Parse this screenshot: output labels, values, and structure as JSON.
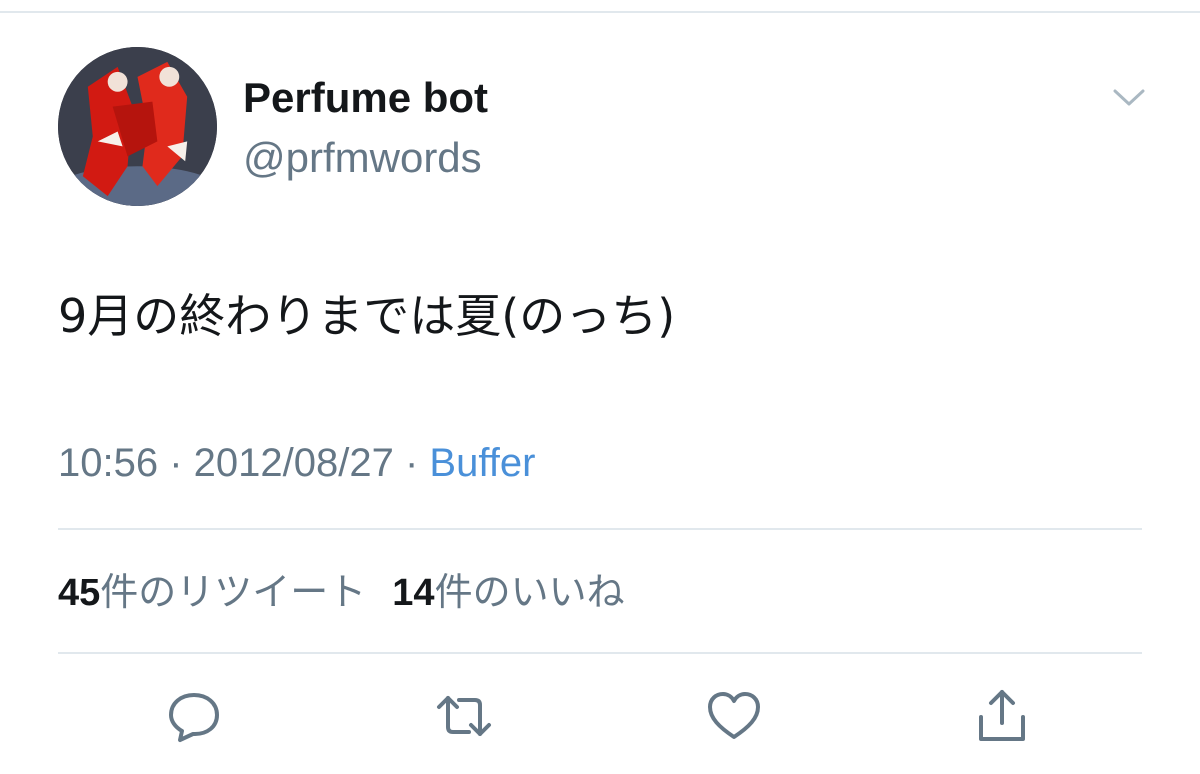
{
  "tweet": {
    "author": {
      "display_name": "Perfume bot",
      "handle": "@prfmwords",
      "avatar_icon": "avatar-photo"
    },
    "text": "9月の終わりまでは夏(のっち)",
    "meta": {
      "time": "10:56",
      "separator": " · ",
      "date": "2012/08/27",
      "source": "Buffer"
    },
    "stats": {
      "retweets_count": "45",
      "retweets_label": "件のリツイート",
      "likes_count": "14",
      "likes_label": "件のいいね"
    },
    "actions": [
      {
        "name": "reply",
        "icon": "reply-icon"
      },
      {
        "name": "retweet",
        "icon": "retweet-icon"
      },
      {
        "name": "like",
        "icon": "heart-icon"
      },
      {
        "name": "share",
        "icon": "share-icon"
      }
    ]
  },
  "colors": {
    "text_primary": "#14171a",
    "text_secondary": "#657786",
    "link": "#4a90d9",
    "divider": "#e1e8ed",
    "icon": "#657786"
  }
}
